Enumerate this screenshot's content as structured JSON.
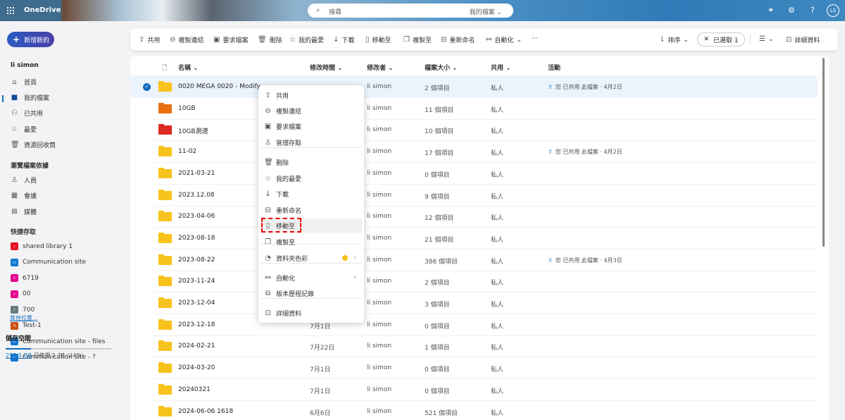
{
  "header": {
    "brand": "OneDrive",
    "search_placeholder": "搜尋",
    "search_scope": "我的檔案",
    "avatar": "LS",
    "help": "?"
  },
  "new_button": "新增新的",
  "sidebar": {
    "user": "li simon",
    "items": [
      {
        "label": "首頁",
        "icon": "home-icon"
      },
      {
        "label": "我的檔案",
        "icon": "folder-icon"
      },
      {
        "label": "已共用",
        "icon": "people-icon"
      },
      {
        "label": "最愛",
        "icon": "star-icon"
      },
      {
        "label": "資源回收筒",
        "icon": "trash-icon"
      }
    ],
    "browse_heading": "瀏覽檔案依據",
    "browse": [
      {
        "label": "人員",
        "icon": "person-icon"
      },
      {
        "label": "會議",
        "icon": "calendar-icon"
      },
      {
        "label": "媒體",
        "icon": "image-icon"
      }
    ],
    "quick_heading": "快捷存取",
    "sites": [
      {
        "label": "shared library 1",
        "color": "#e81123",
        "abbr": "s"
      },
      {
        "label": "Communication site",
        "color": "#0f78d4",
        "abbr": "Cs"
      },
      {
        "label": "6719",
        "color": "#e3008c",
        "abbr": "6"
      },
      {
        "label": "00",
        "color": "#e3008c",
        "abbr": "0"
      },
      {
        "label": "700",
        "color": "#69797e",
        "abbr": "7"
      },
      {
        "label": "Test-1",
        "color": "#ca5010",
        "abbr": "T1"
      },
      {
        "label": "Communication site - files",
        "color": "#0f78d4",
        "abbr": "Cs"
      },
      {
        "label": "Communication site -  ?",
        "color": "#0f78d4",
        "abbr": "Cs"
      }
    ],
    "more_places": "其他位置...",
    "storage_heading": "儲存空間",
    "storage_used": "253.5 GB",
    "storage_text": "已使用 1 TB (24%)",
    "storage_percent": 24
  },
  "toolbar": {
    "share": "共用",
    "copy_link": "複製連結",
    "request_files": "要求檔案",
    "delete": "刪除",
    "favorite": "我的最愛",
    "download": "下載",
    "move_to": "移動至",
    "copy_to": "複製至",
    "rename": "重新命名",
    "automate": "自動化",
    "more": "···",
    "sort": "排序",
    "selected": "已選取 1",
    "details": "詳細資料"
  },
  "columns": {
    "name": "名稱",
    "modified": "修改時間",
    "modified_by": "修改者",
    "size": "檔案大小",
    "sharing": "共用",
    "activity": "活動"
  },
  "rows": [
    {
      "name": "0020 MEGA 0020 - Modify",
      "modified": "",
      "by": "li simon",
      "size": "2 個項目",
      "share": "私人",
      "activity": "您 已共用 此檔案 · 4月2日",
      "color": "#f8c21c",
      "selected": true
    },
    {
      "name": "10GB",
      "modified": "",
      "by": "li simon",
      "size": "11 個項目",
      "share": "私人",
      "activity": "",
      "color": "#e8700f"
    },
    {
      "name": "10GB測速",
      "modified": "",
      "by": "li simon",
      "size": "10 個項目",
      "share": "私人",
      "activity": "",
      "color": "#dd2a23"
    },
    {
      "name": "11-02",
      "modified": "",
      "by": "li simon",
      "size": "17 個項目",
      "share": "私人",
      "activity": "您 已共用 此檔案 · 4月2日",
      "color": "#f8c21c"
    },
    {
      "name": "2021-03-21",
      "modified": "",
      "by": "li simon",
      "size": "0 個項目",
      "share": "私人",
      "activity": "",
      "color": "#f8c21c"
    },
    {
      "name": "2023.12.08",
      "modified": "",
      "by": "li simon",
      "size": "9 個項目",
      "share": "私人",
      "activity": "",
      "color": "#f8c21c"
    },
    {
      "name": "2023-04-06",
      "modified": "",
      "by": "li simon",
      "size": "12 個項目",
      "share": "私人",
      "activity": "",
      "color": "#f8c21c"
    },
    {
      "name": "2023-08-18",
      "modified": "",
      "by": "li simon",
      "size": "21 個項目",
      "share": "私人",
      "activity": "",
      "color": "#f8c21c"
    },
    {
      "name": "2023-08-22",
      "modified": "",
      "by": "li simon",
      "size": "386 個項目",
      "share": "私人",
      "activity": "您 已共用 此檔案 · 4月3日",
      "color": "#f8c21c"
    },
    {
      "name": "2023-11-24",
      "modified": "",
      "by": "li simon",
      "size": "2 個項目",
      "share": "私人",
      "activity": "",
      "color": "#f8c21c"
    },
    {
      "name": "2023-12-04",
      "modified": "",
      "by": "li simon",
      "size": "3 個項目",
      "share": "私人",
      "activity": "",
      "color": "#f8c21c"
    },
    {
      "name": "2023-12-18",
      "modified": "7月1日",
      "by": "li simon",
      "size": "0 個項目",
      "share": "私人",
      "activity": "",
      "color": "#f8c21c"
    },
    {
      "name": "2024-02-21",
      "modified": "7月22日",
      "by": "li simon",
      "size": "1 個項目",
      "share": "私人",
      "activity": "",
      "color": "#f8c21c"
    },
    {
      "name": "2024-03-20",
      "modified": "7月1日",
      "by": "li simon",
      "size": "0 個項目",
      "share": "私人",
      "activity": "",
      "color": "#f8c21c"
    },
    {
      "name": "20240321",
      "modified": "7月1日",
      "by": "li simon",
      "size": "0 個項目",
      "share": "私人",
      "activity": "",
      "color": "#f8c21c"
    },
    {
      "name": "2024-06-06 1618",
      "modified": "6月6日",
      "by": "li simon",
      "size": "521 個項目",
      "share": "私人",
      "activity": "",
      "color": "#f8c21c"
    }
  ],
  "context_menu": [
    {
      "label": "共用",
      "icon": "share-icon",
      "glyph": "⇪"
    },
    {
      "label": "複製連結",
      "icon": "link-icon",
      "glyph": "⊖"
    },
    {
      "label": "要求檔案",
      "icon": "request-folder-icon",
      "glyph": "▣"
    },
    {
      "label": "管理存取",
      "icon": "person-icon",
      "glyph": "♙"
    },
    {
      "label": "刪除",
      "icon": "trash-icon",
      "glyph": "🗑"
    },
    {
      "label": "我的最愛",
      "icon": "star-icon",
      "glyph": "☆"
    },
    {
      "label": "下載",
      "icon": "download-icon",
      "glyph": "↓"
    },
    {
      "label": "重新命名",
      "icon": "rename-icon",
      "glyph": "⊟"
    },
    {
      "label": "移動至",
      "icon": "move-icon",
      "glyph": "▯"
    },
    {
      "label": "複製至",
      "icon": "copy-icon",
      "glyph": "❐"
    },
    {
      "label": "資料夾色彩",
      "icon": "palette-icon",
      "glyph": "◔"
    },
    {
      "label": "自動化",
      "icon": "automate-icon",
      "glyph": "⚯"
    },
    {
      "label": "版本歷程記錄",
      "icon": "history-icon",
      "glyph": "⧉"
    },
    {
      "label": "詳細資料",
      "icon": "details-icon",
      "glyph": "⊡"
    }
  ],
  "folder_color_swatch": "#f8c21c"
}
